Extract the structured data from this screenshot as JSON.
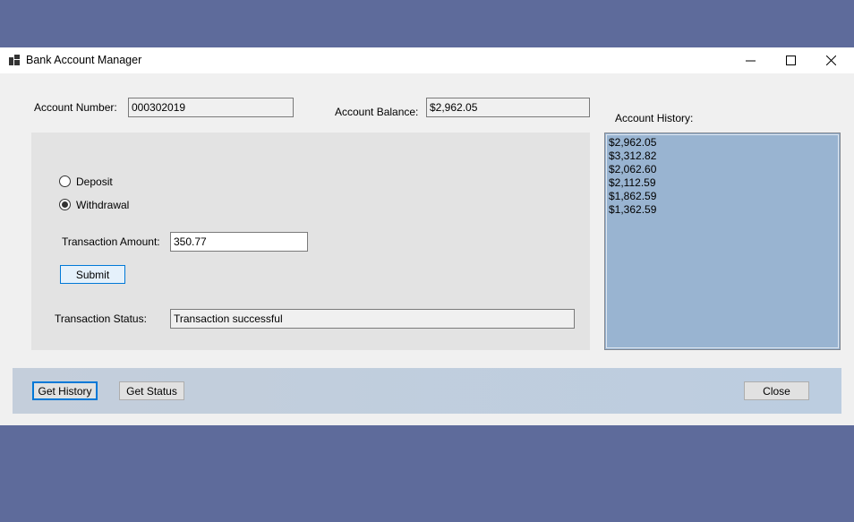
{
  "window": {
    "title": "Bank Account Manager",
    "minimize_glyph": "—",
    "maximize_glyph": "☐",
    "close_glyph": "✕"
  },
  "account": {
    "number_label": "Account Number:",
    "number_value": "000302019",
    "balance_label": "Account Balance:",
    "balance_value": "$2,962.05"
  },
  "transaction": {
    "deposit_label": "Deposit",
    "withdrawal_label": "Withdrawal",
    "selected": "Withdrawal",
    "amount_label": "Transaction Amount:",
    "amount_value": "350.77",
    "submit_label": "Submit",
    "status_label": "Transaction Status:",
    "status_value": "Transaction successful"
  },
  "history": {
    "label": "Account History:",
    "items": [
      "$2,962.05",
      "$3,312.82",
      "$2,062.60",
      "$2,112.59",
      "$1,862.59",
      "$1,362.59"
    ]
  },
  "actions": {
    "get_history_label": "Get History",
    "get_status_label": "Get Status",
    "close_label": "Close"
  },
  "colors": {
    "desktop": "#5e6b9b",
    "history_background": "#99b4d1",
    "focus_accent": "#0078d7"
  },
  "icons": {
    "app": "app-icon",
    "minimize": "minimize-icon",
    "maximize": "maximize-icon",
    "close": "close-icon"
  }
}
